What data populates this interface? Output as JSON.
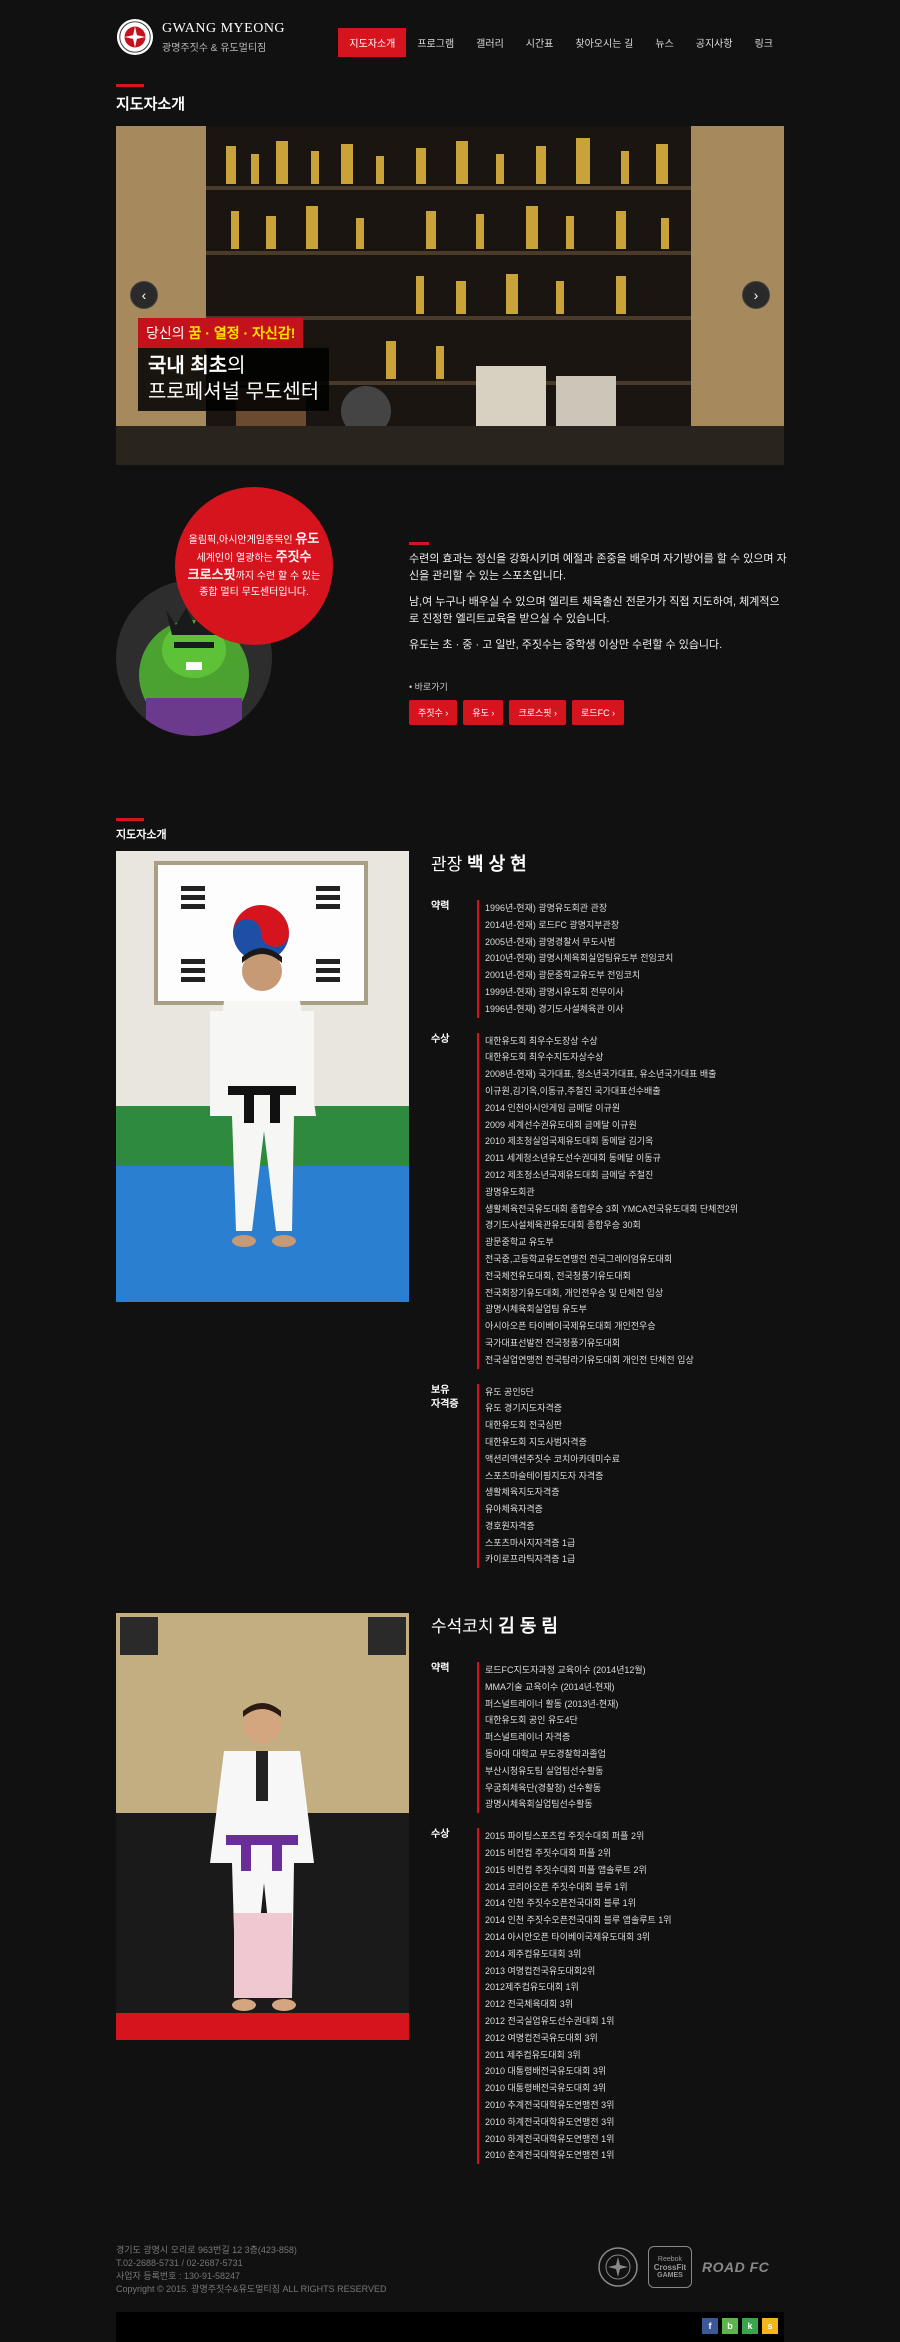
{
  "header": {
    "logo_title": "GWANG MYEONG",
    "logo_sub": "광명주짓수 & 유도멀티짐",
    "nav": [
      "지도자소개",
      "프로그램",
      "갤러리",
      "시간표",
      "찾아오시는 길",
      "뉴스",
      "공지사항",
      "링크"
    ]
  },
  "page": {
    "title": "지도자소개",
    "section_title": "지도자소개"
  },
  "hero": {
    "tag_pre": "당신의 ",
    "tag_highlight": "꿈 · 열정 · 자신감!",
    "headline_1_bold": "국내 최초",
    "headline_1_rest": "의",
    "headline_2": "프로페셔널 무도센터"
  },
  "intro": {
    "circle_line1_pre": "올림픽,아시안게임종목인 ",
    "circle_line1_big": "유도",
    "circle_line2_pre": "세계인이 열광하는 ",
    "circle_line2_big": "주짓수",
    "circle_line3_big": "크로스핏",
    "circle_line3_rest": "까지 수련 할 수 있는",
    "circle_line4": "종합 멀티 무도센터입니다.",
    "para1": "수련의 효과는 정신을 강화시키며 예절과 존중을 배우며 자기방어를 할 수 있으며 자신을 관리할 수 있는 스포츠입니다.",
    "para2": "남,여 누구나 배우실 수 있으며 엘리트 체육출신 전문가가 직접 지도하여, 체계적으로 진정한 엘리트교육을 받으실 수 있습니다.",
    "para3": "유도는 초 · 중 · 고 일반, 주짓수는 중학생 이상만 수련할 수 있습니다.",
    "shortcut_label": "• 바로가기",
    "buttons": [
      "주짓수 ›",
      "유도 ›",
      "크로스핏 ›",
      "로드FC ›"
    ]
  },
  "instructors": [
    {
      "title": "관장 ",
      "name": "백 상 현",
      "groups": [
        {
          "label": "약력",
          "items": [
            "1996년-현재) 광명유도회관 관장",
            "2014년-현재) 로드FC 광명지부관장",
            "2005년-현재) 광명경찰서 무도사범",
            "2010년-현재) 광명시체육회실업팀유도부 전임코치",
            "2001년-현재) 광문중학교유도부 전임코치",
            "1999년-현재) 광명시유도회 전무이사",
            "1996년-현재) 경기도사설체육관 이사"
          ]
        },
        {
          "label": "수상",
          "items": [
            "대한유도회 최우수도장상 수상",
            "대한유도회 최우수지도자상수상",
            "2008년-현재) 국가대표, 청소년국가대표, 유소년국가대표 배출",
            "이규원,김기옥,이동규,주철진 국가대표선수배출",
            "2014 인천아시안게임 금메달 이규원",
            "2009 세계선수권유도대회 금메달 이규원",
            "2010 제초청실업국제유도대회 동메달 김기옥",
            "2011 세계청소년유도선수권대회 동메달 이동규",
            "2012 제초청소년국제유도대회 금메달 주철진",
            "광명유도회관",
            "생활체육전국유도대회 종합우승 3회 YMCA전국유도대회 단체전2위",
            "경기도사설체육관유도대회 종합우승 30회",
            "광문중학교 유도부",
            "전국중,고등학교유도연맹전 전국그레이엄유도대회",
            "전국체전유도대회, 전국청풍기유도대회",
            "전국회장기유도대회, 개인전우승 및 단체전 입상",
            "광명시체육회실업팀 유도부",
            "아시아오픈 타이베이국제유도대회 개인전우승",
            "국가대표선발전 전국청풍기유도대회",
            "전국실업연맹전 전국탐라기유도대회 개인전 단체전 입상"
          ]
        },
        {
          "label": "보유\n자격증",
          "items": [
            "유도 공인5단",
            "유도 경기지도자격증",
            "대한유도회 전국심판",
            "대한유도회 지도사범자격증",
            "액션리액션주짓수 코치아카데미수료",
            "스포츠마슬테이핑지도자 자격증",
            "생활체육지도자격증",
            "유아체육자격증",
            "경호원자격증",
            "스포츠마사지자격증 1급",
            "카이로프라틱자격증 1급"
          ]
        }
      ]
    },
    {
      "title": "수석코치 ",
      "name": "김 동 림",
      "groups": [
        {
          "label": "약력",
          "items": [
            "로드FC지도자과정 교육이수 (2014년12월)",
            "MMA기술 교육이수 (2014년-현재)",
            "퍼스널트레이너 활동 (2013년-현재)",
            "대한유도회 공인 유도4단",
            "퍼스널트레이너 자격증",
            "동아대 대학교 무도경찰학과졸업",
            "부산시청유도팀 실업팀선수활동",
            "우굼회체육단(경찰청) 선수활동",
            "광명시체육회실업팀선수활동"
          ]
        },
        {
          "label": "수상",
          "items": [
            "2015 파이팅스포츠컵 주짓수대회 퍼플 2위",
            "2015 비컨컵 주짓수대회 퍼플 2위",
            "2015 비컨컵 주짓수대회 퍼플 앱솔루트 2위",
            "2014 코리아오픈 주짓수대회 블루 1위",
            "2014 인천 주짓수오픈전국대회 블루 1위",
            "2014 인천 주짓수오픈전국대회 블루 앱솔루트 1위",
            "2014 아시안오픈 타이베이국제유도대회 3위",
            "2014 제주컵유도대회 3위",
            "2013 여명컵전국유도대회2위",
            "2012제주컵유도대회 1위",
            "2012 전국체육대회 3위",
            "2012 전국실업유도선수권대회 1위",
            "2012 여명컵전국유도대회 3위",
            "2011 제주컵유도대회 3위",
            "2010 대통령배전국유도대회 3위",
            "2010 대통령배전국유도대회 3위",
            "2010 추계전국대학유도연맹전 3위",
            "2010 하계전국대학유도연맹전 3위",
            "2010 하계전국대학유도연맹전 1위",
            "2010 춘계전국대학유도연맹전 1위"
          ]
        }
      ]
    }
  ],
  "footer": {
    "line1": "경기도 광명시 오리로 963번길 12 3층(423-858)",
    "line2": "T.02-2688-5731 / 02-2687-5731",
    "line3": "사업자 등록번호 : 130-91-58247",
    "line4": "Copyright © 2015. 광명주짓수&유도멀티짐 ALL RIGHTS RESERVED",
    "logo_crossfit_top": "Reebok",
    "logo_crossfit_mid": "CrossFit",
    "logo_crossfit_bot": "GAMES",
    "logo_roadfc": "ROAD FC",
    "social": [
      "f",
      "b",
      "k",
      "s"
    ]
  },
  "colors": {
    "accent": "#d6141e",
    "background": "#111111",
    "highlight": "#ffe600"
  },
  "icons": [
    "logo-emblem-icon",
    "chevron-left-icon",
    "chevron-right-icon",
    "facebook-icon",
    "blog-icon",
    "kakaotalk-icon",
    "kakaostory-icon"
  ]
}
